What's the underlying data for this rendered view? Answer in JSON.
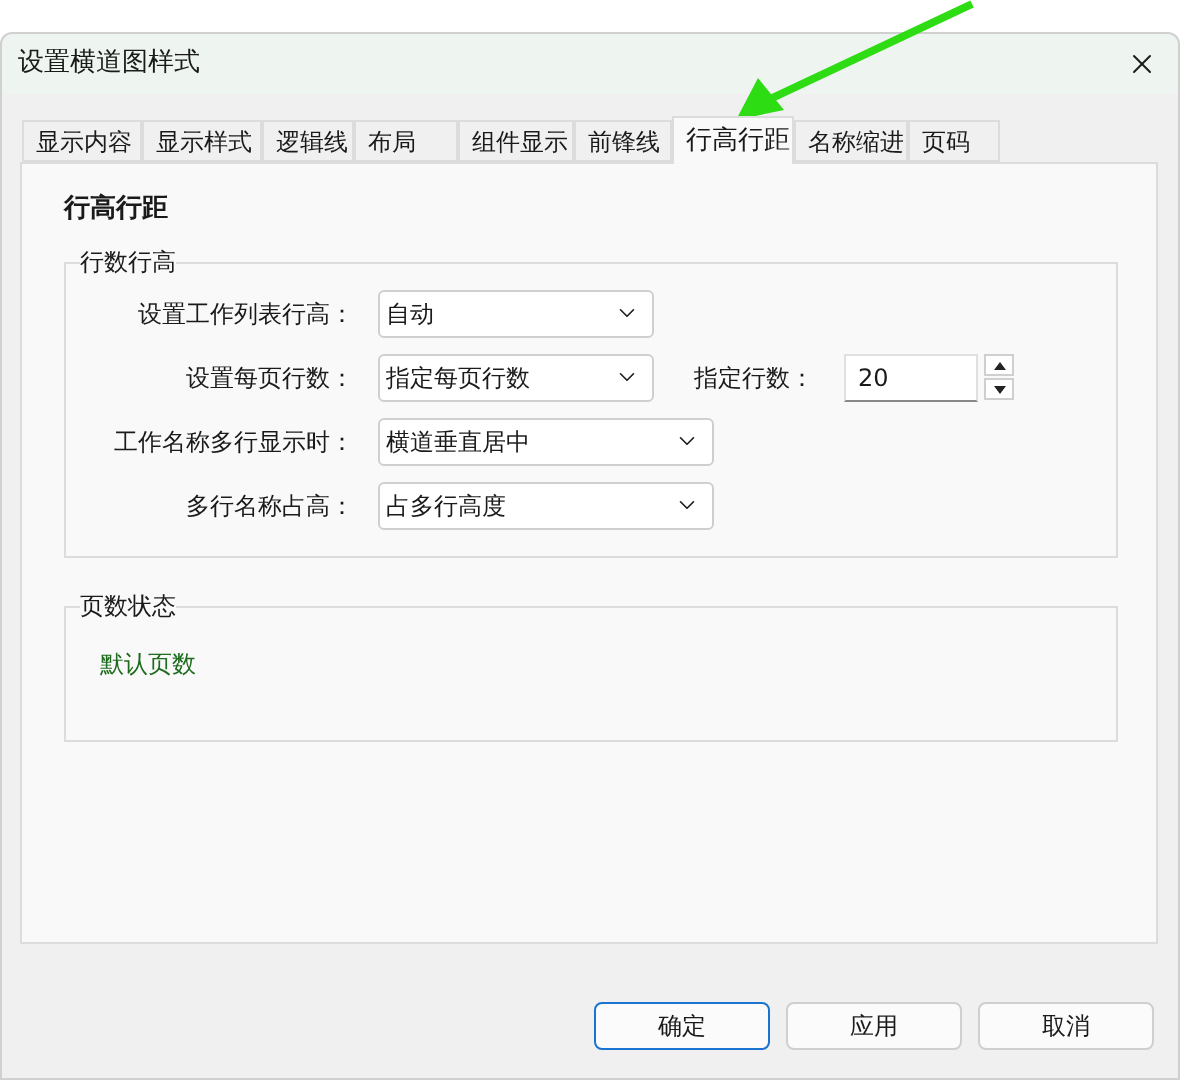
{
  "window": {
    "title": "设置横道图样式"
  },
  "tabs": [
    {
      "label": "显示内容",
      "selected": false
    },
    {
      "label": "显示样式",
      "selected": false
    },
    {
      "label": "逻辑线",
      "selected": false
    },
    {
      "label": "布局",
      "selected": false
    },
    {
      "label": "组件显示",
      "selected": false
    },
    {
      "label": "前锋线",
      "selected": false
    },
    {
      "label": "行高行距",
      "selected": true
    },
    {
      "label": "名称缩进",
      "selected": false
    },
    {
      "label": "页码",
      "selected": false
    }
  ],
  "section_title": "行高行距",
  "row_group": {
    "title": "行数行高",
    "fields": [
      {
        "label": "设置工作列表行高：",
        "value": "自动"
      },
      {
        "label": "设置每页行数：",
        "value": "指定每页行数",
        "extra": {
          "label": "指定行数：",
          "value": "20"
        }
      },
      {
        "label": "工作名称多行显示时：",
        "value": "横道垂直居中"
      },
      {
        "label": "多行名称占高：",
        "value": "占多行高度"
      }
    ]
  },
  "page_group": {
    "title": "页数状态",
    "status": "默认页数"
  },
  "buttons": [
    {
      "label": "确定",
      "default": true
    },
    {
      "label": "应用",
      "default": false
    },
    {
      "label": "取消",
      "default": false
    }
  ]
}
